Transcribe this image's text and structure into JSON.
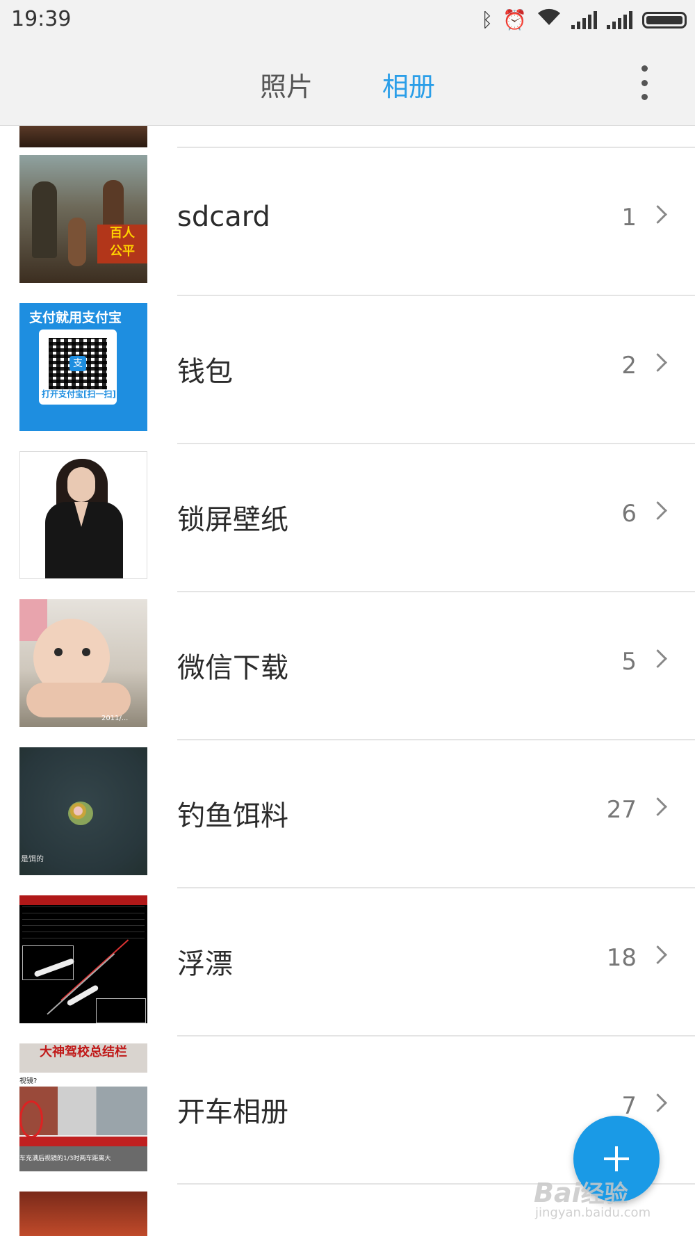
{
  "status_bar": {
    "time": "19:39",
    "icons": [
      "bluetooth-icon",
      "alarm-icon",
      "wifi-icon",
      "signal-icon",
      "signal-icon",
      "battery-icon"
    ]
  },
  "app_bar": {
    "tabs": [
      {
        "label": "照片",
        "active": false
      },
      {
        "label": "相册",
        "active": true
      }
    ],
    "accent_color": "#2a9ee8",
    "more_icon": "more-vertical-icon"
  },
  "albums": [
    {
      "name": "sdcard",
      "count": "1"
    },
    {
      "name": "钱包",
      "count": "2"
    },
    {
      "name": "锁屏壁纸",
      "count": "6"
    },
    {
      "name": "微信下载",
      "count": "5"
    },
    {
      "name": "钓鱼饵料",
      "count": "27"
    },
    {
      "name": "浮漂",
      "count": "18"
    },
    {
      "name": "开车相册",
      "count": "7"
    }
  ],
  "thumb_text": {
    "sdcard_banner": "百人\n公平",
    "wallet_header": "支付就用支付宝",
    "wallet_footer": "打开支付宝[扫一扫]",
    "wallet_logo": "支",
    "wechat_stamp": "2011/...",
    "bait_caption": "是饵的",
    "driving_header": "大神驾校总结栏",
    "driving_line1": "视镜?",
    "driving_line2": "车充满后视镜的1/3时两车距离大"
  },
  "fab": {
    "icon": "plus-icon",
    "color": "#1a9ae6"
  },
  "watermark": {
    "brand": "Bai",
    "brand2": "经验",
    "url": "jingyan.baidu.com"
  }
}
